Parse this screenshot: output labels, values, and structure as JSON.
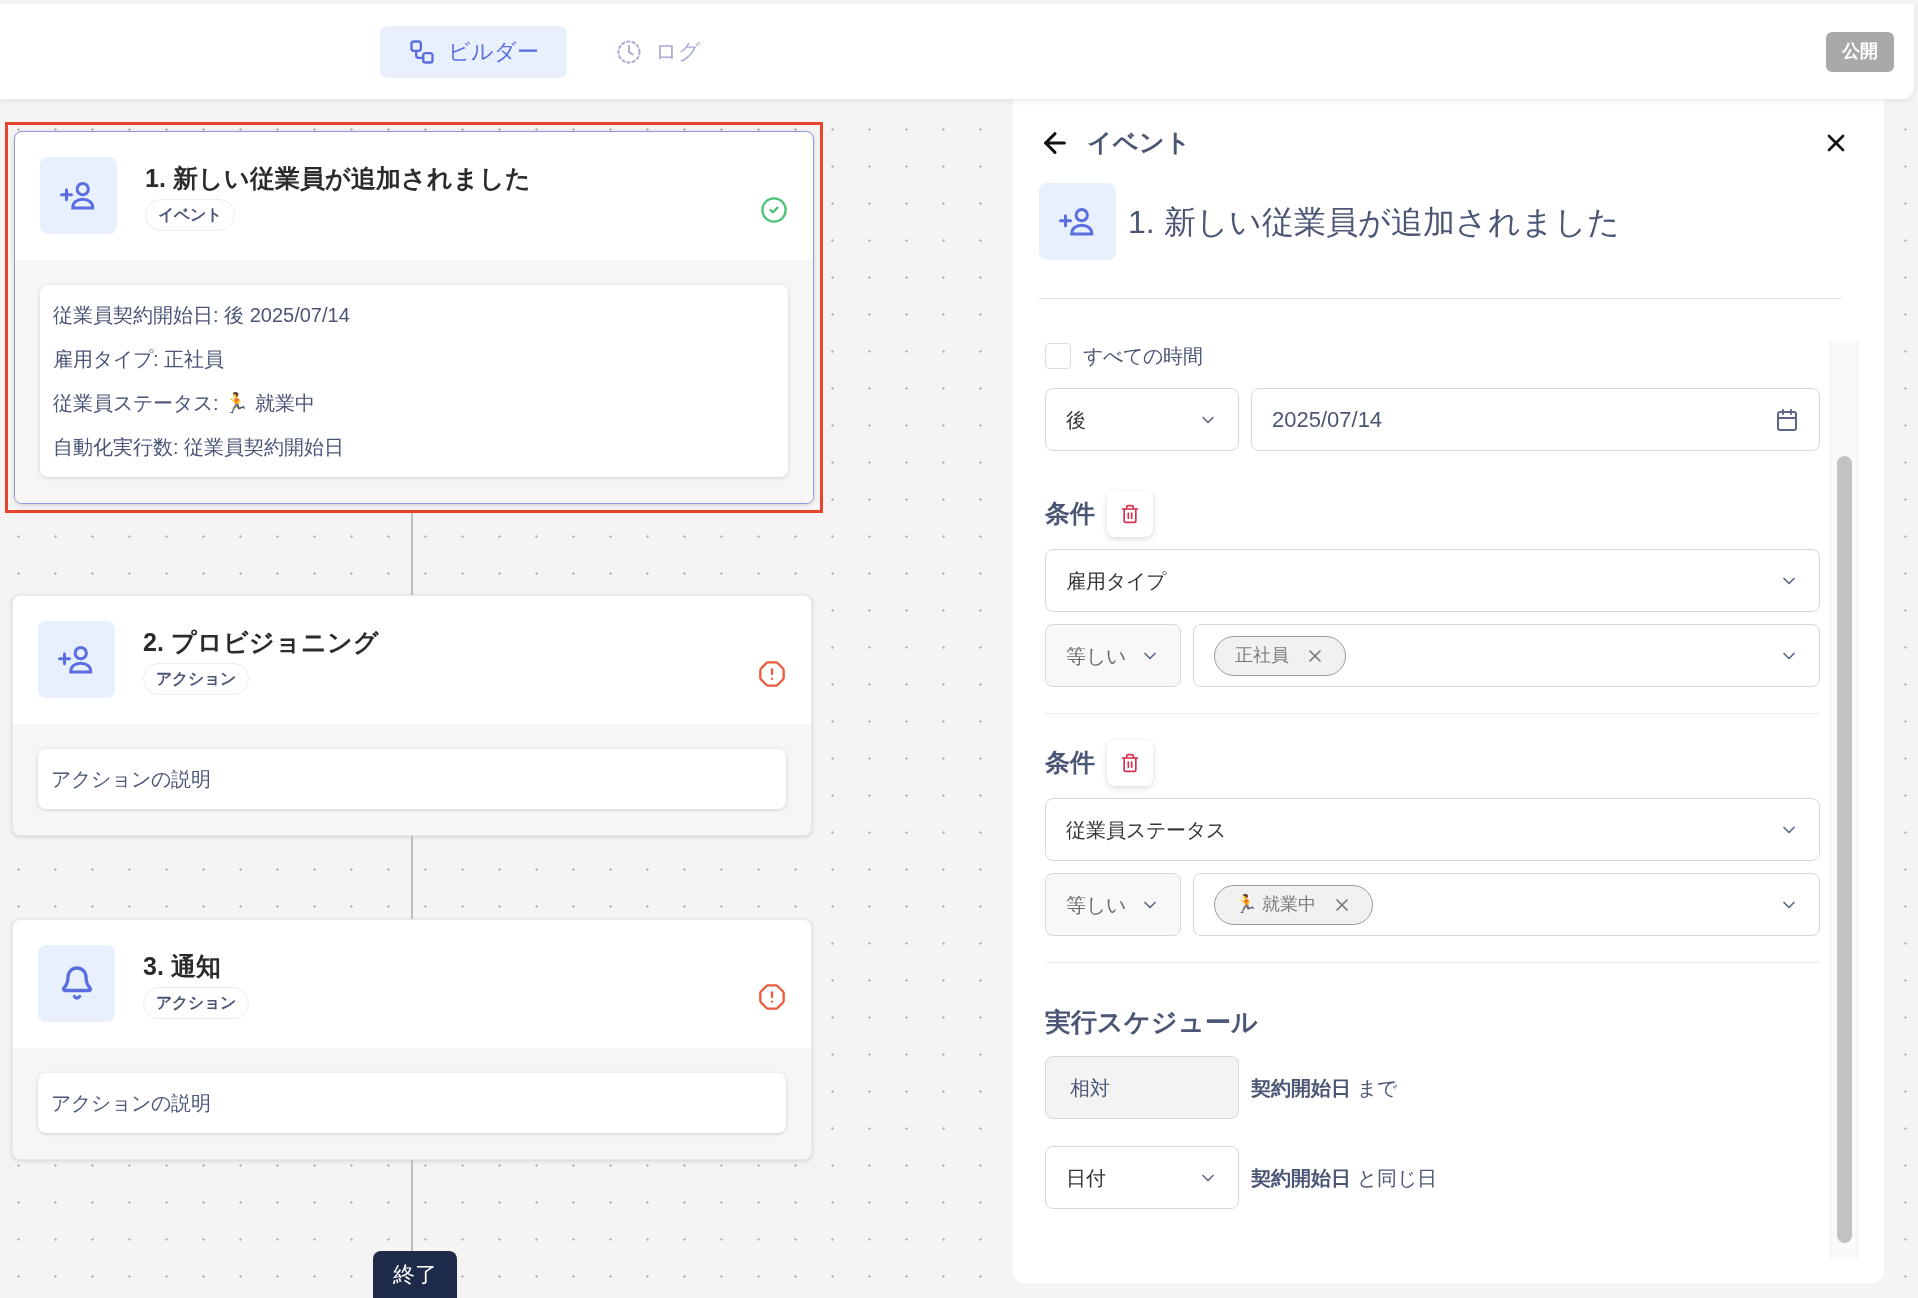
{
  "top_bar": {
    "tabs": [
      {
        "label": "ビルダー",
        "kind": "flow",
        "selected": true
      },
      {
        "label": "ログ",
        "kind": "clock",
        "selected": false
      }
    ],
    "publish_button": {
      "label": "公開",
      "disabled": true
    }
  },
  "canvas": {
    "steps": [
      {
        "title": "1. 新しい従業員が追加されました",
        "badge": "イベント",
        "kind": "user-plus",
        "valid": true,
        "selected": true,
        "details": [
          "従業員契約開始日: 後 2025/07/14",
          "雇用タイプ: 正社員",
          "従業員ステータス: 🏃 就業中",
          "自動化実行数: 従業員契約開始日"
        ]
      },
      {
        "title": "2. プロビジョニング",
        "badge": "アクション",
        "kind": "user-plus",
        "valid": false,
        "selected": false,
        "details": [
          "アクションの説明"
        ]
      },
      {
        "title": "3. 通知",
        "badge": "アクション",
        "kind": "bell",
        "valid": false,
        "selected": false,
        "details": [
          "アクションの説明"
        ]
      }
    ],
    "end_button": "終了"
  },
  "panel": {
    "back_title": "イベント",
    "title": "1. 新しい従業員が追加されました",
    "all_time": {
      "label": "すべての時間",
      "checked": false
    },
    "timing": "後",
    "date": "2025/07/14",
    "conditions": [
      {
        "heading": "条件",
        "field": "雇用タイプ",
        "operator": "等しい",
        "values": [
          "正社員"
        ]
      },
      {
        "heading": "条件",
        "field": "従業員ステータス",
        "operator": "等しい",
        "values": [
          "🏃 就業中"
        ]
      }
    ],
    "schedule": {
      "heading": "実行スケジュール",
      "rows": [
        {
          "kind": "static",
          "value": "相対",
          "text": "**契約開始日** まで"
        },
        {
          "kind": "select",
          "value": "日付",
          "text": "**契約開始日** と同じ日"
        }
      ]
    }
  }
}
